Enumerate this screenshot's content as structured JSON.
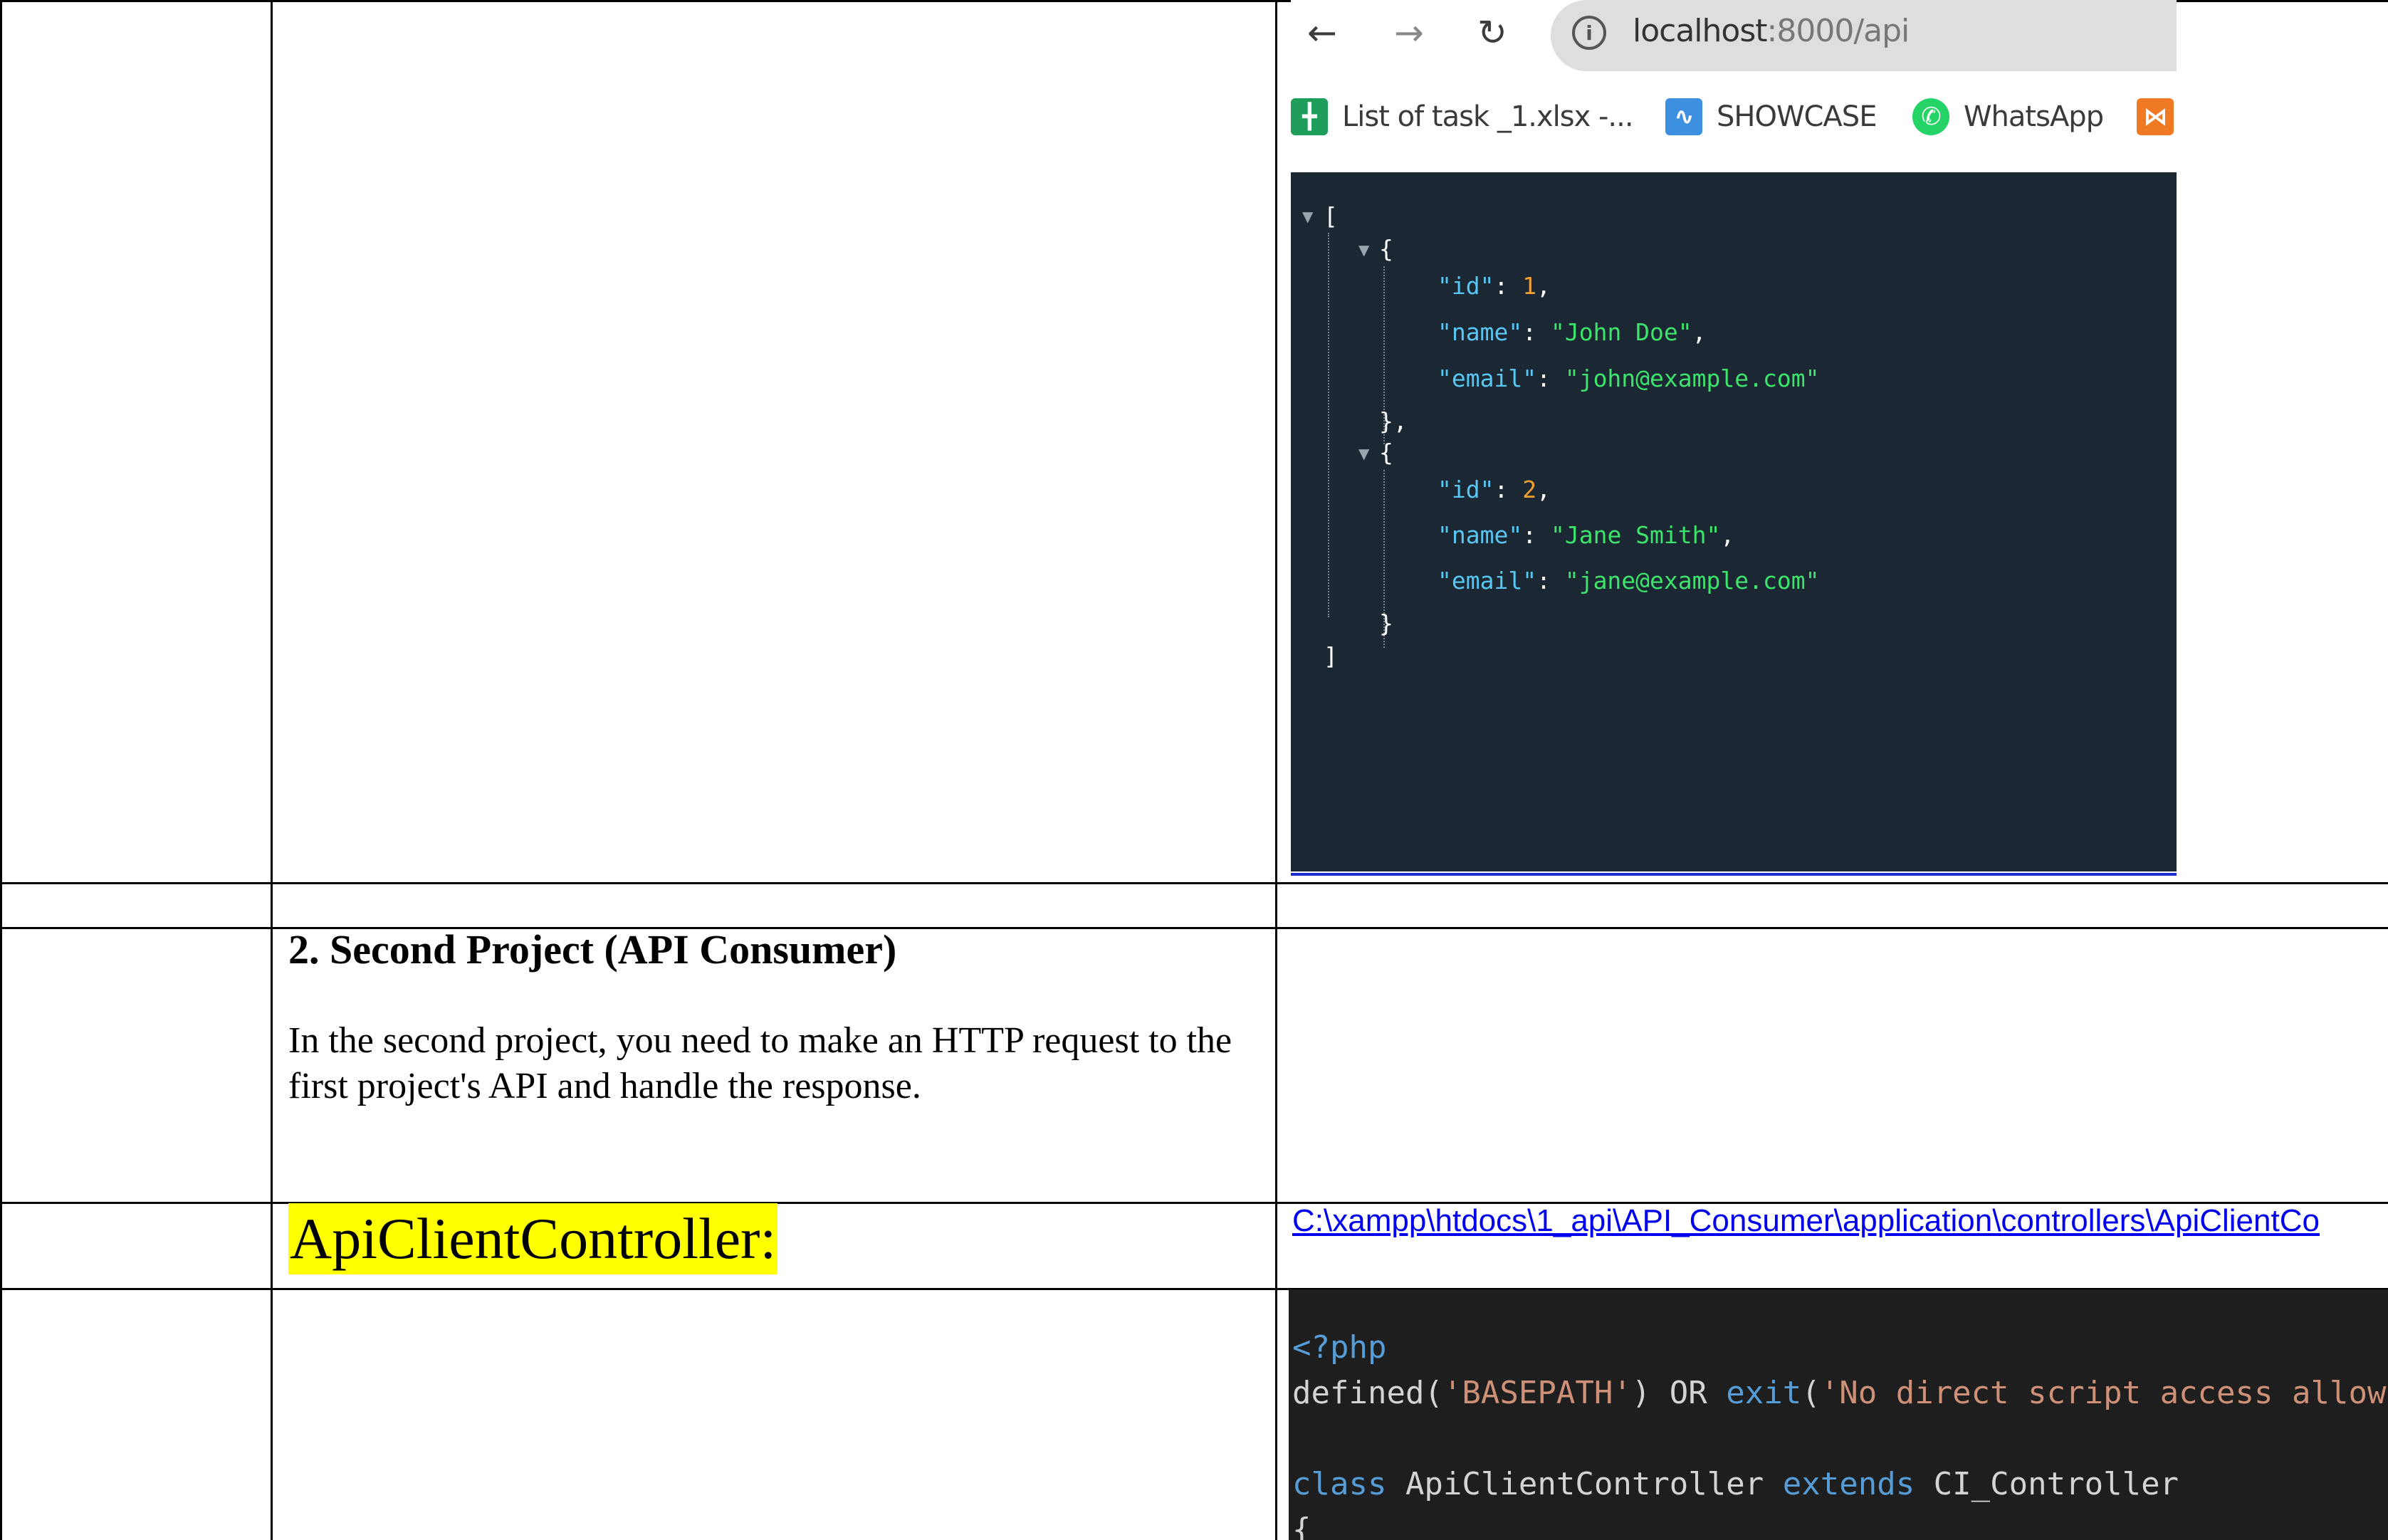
{
  "browser": {
    "nav": {
      "back_icon": "arrow-left-icon",
      "forward_icon": "arrow-right-icon",
      "reload_icon": "reload-icon",
      "info_icon": "info-icon"
    },
    "url_host": "localhost",
    "url_path": ":8000/api",
    "bookmarks": [
      {
        "label": "List of task _1.xlsx -...",
        "icon": "spreadsheet-icon",
        "color": "#1e9e5a"
      },
      {
        "label": "SHOWCASE",
        "icon": "showcase-icon",
        "color": "#3d8fe0"
      },
      {
        "label": "WhatsApp",
        "icon": "whatsapp-icon",
        "color": "#25d366"
      },
      {
        "label": "",
        "icon": "xampp-icon",
        "color": "#f07a24"
      }
    ]
  },
  "json_viewer": {
    "open_bracket": "[",
    "close_bracket": "]",
    "records": [
      {
        "id": "1",
        "name": "\"John Doe\"",
        "email": "\"john@example.com\""
      },
      {
        "id": "2",
        "name": "\"Jane Smith\"",
        "email": "\"jane@example.com\""
      }
    ],
    "keys": {
      "id": "\"id\"",
      "name": "\"name\"",
      "email": "\"email\""
    }
  },
  "section": {
    "heading": "2. Second Project (API Consumer)",
    "paragraph": "In the second project, you need to make an HTTP request to the first project's API and handle the response.",
    "controller_label": "ApiClientController:",
    "file_path": "C:\\xampp\\htdocs\\1_api\\API_Consumer\\application\\controllers\\ApiClientCo"
  },
  "code": {
    "line1": "<?php",
    "line2_fn": "defined(",
    "line2_arg": "'BASEPATH'",
    "line2_mid": ") OR ",
    "line2_exit": "exit",
    "line2_paren": "(",
    "line2_msg": "'No direct script access allowe",
    "line4_class": "class",
    "line4_name": " ApiClientController ",
    "line4_extends": "extends",
    "line4_parent": " CI_Controller",
    "line5": "{"
  },
  "colors": {
    "json_bg": "#1b2733",
    "code_bg": "#1e1e1e",
    "highlight": "#ffff00",
    "link": "#0000ee"
  }
}
